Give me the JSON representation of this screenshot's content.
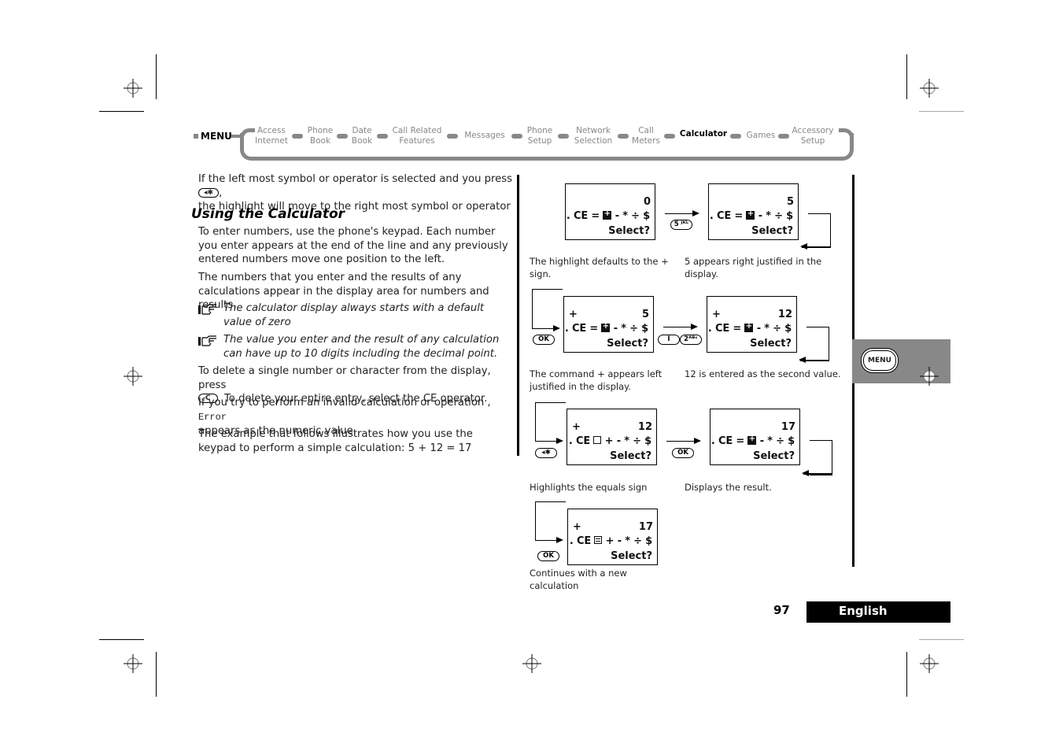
{
  "nav": {
    "menu_label": "MENU",
    "items": [
      {
        "label": "Access\nInternet",
        "active": false
      },
      {
        "label": "Phone\nBook",
        "active": false
      },
      {
        "label": "Date\nBook",
        "active": false
      },
      {
        "label": "Call Related\nFeatures",
        "active": false
      },
      {
        "label": "Messages",
        "active": false
      },
      {
        "label": "Phone\nSetup",
        "active": false
      },
      {
        "label": "Network\nSelection",
        "active": false
      },
      {
        "label": "Call\nMeters",
        "active": false
      },
      {
        "label": "Calculator",
        "active": true
      },
      {
        "label": "Games",
        "active": false
      },
      {
        "label": "Accessory\nSetup",
        "active": false
      }
    ]
  },
  "intro": {
    "line1_pre": "If the left most symbol or operator is selected and you press ",
    "line1_key": "◂✱",
    "line1_post": ",",
    "line2": "the highlight will move to the right most symbol or operator"
  },
  "section": {
    "heading": "Using the Calculator",
    "para1": "To enter numbers, use the phone's keypad. Each number you enter appears at the end of the line and any previously entered numbers move one position to the left.",
    "para2": "The numbers that you enter and the results of any calculations appear in the display area for numbers and results.",
    "note1": "The calculator display always starts with a default value of zero",
    "note2": "The value you enter and the result of any calculation can have up to 10 digits including the decimal point.",
    "para3_pre": "To delete a single number or character from the display, press",
    "para3_key": "C",
    "para3_post": ". To delete your entire entry, select the CE operator.",
    "para4_pre": "If you try to perform an invalid calculation or operation , ",
    "para4_code": "Error",
    "para4_post": "appears as the numeric value.",
    "para5": "The example that follows illustrates how you use the keypad to perform a simple calculation: 5 + 12 = 17"
  },
  "diagram": {
    "ops_tail": "- * ÷ $",
    "ops_tail_plus": "+ - * ÷ $",
    "ce_eq": ". CE =",
    "ce": ". CE",
    "select": "Select?",
    "screens": [
      {
        "op": "",
        "value": "0"
      },
      {
        "op": "",
        "value": "5"
      },
      {
        "op": "+",
        "value": "5"
      },
      {
        "op": "+",
        "value": "12"
      },
      {
        "op": "+",
        "value": "12"
      },
      {
        "op": "",
        "value": "17"
      },
      {
        "op": "+",
        "value": "17"
      }
    ],
    "keys": {
      "five": "5 ᴶᴷᴸ",
      "ok": "OK",
      "one": "I",
      "two": "2ᴬᴮᶜ",
      "star": "◂✱"
    },
    "captions": [
      "The highlight defaults to the + sign.",
      "5 appears right justified in the display.",
      "The command + appears left justified in the display.",
      "12 is entered as the second value.",
      "Highlights the equals sign",
      "Displays the result.",
      "Continues with a new calculation"
    ]
  },
  "side_tab": {
    "menu_button": "MENU"
  },
  "footer": {
    "page_number": "97",
    "language": "English"
  }
}
